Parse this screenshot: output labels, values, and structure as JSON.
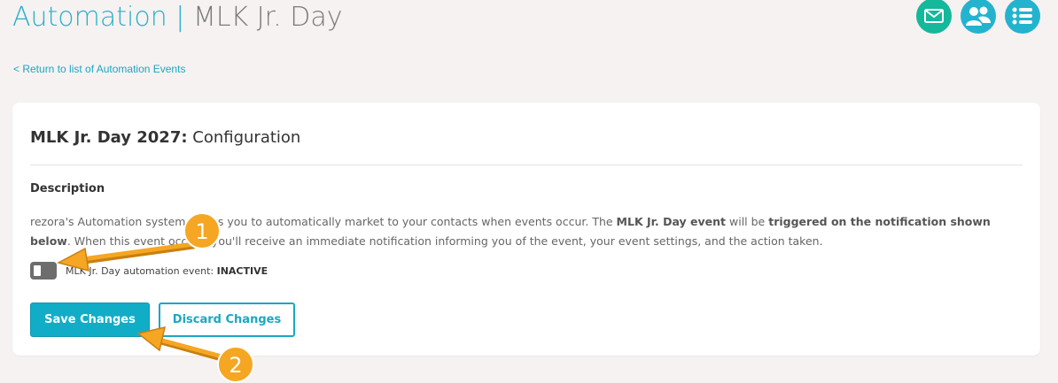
{
  "header": {
    "title_section": "Automation",
    "title_separator": "|",
    "title_event": "MLK Jr. Day",
    "icons": [
      {
        "name": "mail-icon",
        "color": "#14b89a"
      },
      {
        "name": "contacts-icon",
        "color": "#23b3cf"
      },
      {
        "name": "list-icon",
        "color": "#23b3cf"
      }
    ]
  },
  "nav": {
    "back_link": "< Return to list of Automation Events"
  },
  "card": {
    "title_bold": "MLK Jr. Day 2027:",
    "title_rest": " Configuration",
    "description_heading": "Description",
    "description": {
      "part1": "rezora's Automation system allows you to automatically market to your contacts when events occur. The ",
      "bold1": "MLK Jr. Day event",
      "part2": " will be ",
      "bold2": "triggered on the notification shown below",
      "part3": ". When this event occurs, you'll receive an immediate notification informing you of the event, your event settings, and the action taken."
    },
    "toggle": {
      "label": "MLK Jr. Day automation event: ",
      "status": "INACTIVE",
      "on": false
    },
    "buttons": {
      "save": "Save Changes",
      "discard": "Discard Changes"
    }
  },
  "annotations": {
    "marker1": "1",
    "marker2": "2",
    "color": "#f5a623"
  }
}
